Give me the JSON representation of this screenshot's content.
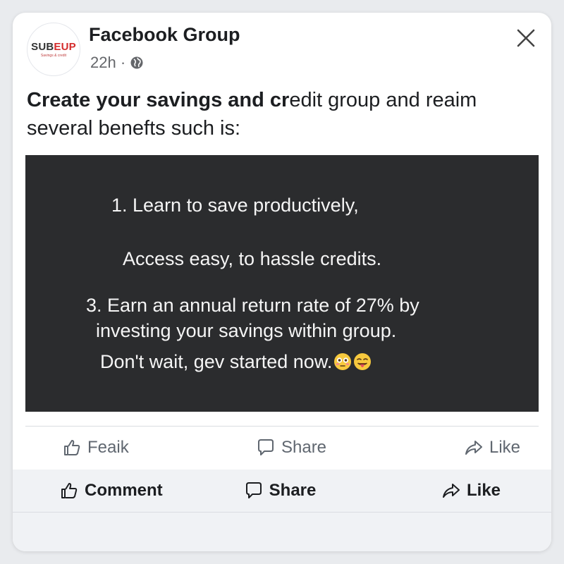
{
  "post": {
    "group_name": "Facebook Group",
    "time": "22h ·",
    "avatar": {
      "logo_text_a": "SUB",
      "logo_text_b": "EUP",
      "logo_tagline": "Savings & credit"
    },
    "text_bold": "Create your savings and cr",
    "text_rest_line1": "edit group and reaim",
    "text_line2": "several benefts such is:"
  },
  "media": {
    "line1": "1. Learn to save productively,",
    "line2": "Access easy, to hassle credits.",
    "line3": "3. Earn an annual return rate of 27% by",
    "line4": "investing your savings within group.",
    "line5": "Don't wait, gev started now."
  },
  "actions_row1": {
    "like_label": "Feaik",
    "comment_label": "Share",
    "share_label": "Like"
  },
  "actions_row2": {
    "like_label": "Comment",
    "comment_label": "Share",
    "share_label": "Like"
  },
  "icons": {
    "close": "close-icon",
    "globe": "globe-icon",
    "thumbs_up": "thumbs-up-icon",
    "comment": "comment-bubble-icon",
    "share": "share-arrow-icon",
    "emoji1": "flushed-face-emoji",
    "emoji2": "tongue-wink-emoji"
  },
  "colors": {
    "card_bg": "#ffffff",
    "page_bg": "#e9ebee",
    "media_bg": "#2b2c2e",
    "logo_accent": "#d42a2a",
    "meta_text": "#65676b"
  }
}
